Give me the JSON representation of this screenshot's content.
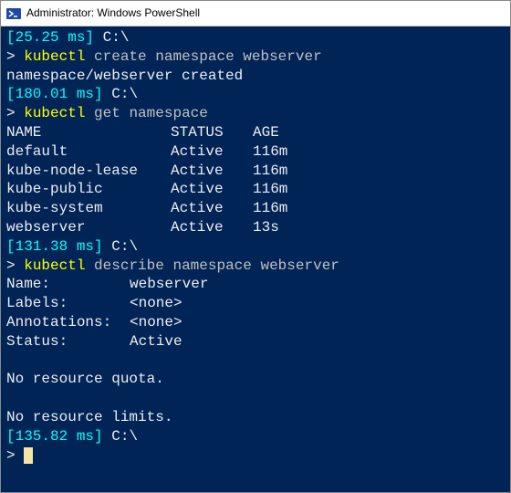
{
  "window": {
    "title": "Administrator: Windows PowerShell",
    "icon": "powershell-icon"
  },
  "colors": {
    "bg": "#012456",
    "cyan": "#00ffff",
    "yellow": "#ffff00",
    "white": "#eeedf0"
  },
  "prompts": {
    "p0": {
      "timing": "[25.25 ms]",
      "path": "C:\\",
      "caret": ">",
      "cmd": "kubectl",
      "args": "create namespace webserver"
    },
    "out0": "namespace/webserver created",
    "p1": {
      "timing": "[180.01 ms]",
      "path": "C:\\",
      "caret": ">",
      "cmd": "kubectl",
      "args": "get namespace"
    },
    "table": {
      "header": {
        "name": "NAME",
        "status": "STATUS",
        "age": "AGE"
      },
      "rows": [
        {
          "name": "default",
          "status": "Active",
          "age": "116m"
        },
        {
          "name": "kube-node-lease",
          "status": "Active",
          "age": "116m"
        },
        {
          "name": "kube-public",
          "status": "Active",
          "age": "116m"
        },
        {
          "name": "kube-system",
          "status": "Active",
          "age": "116m"
        },
        {
          "name": "webserver",
          "status": "Active",
          "age": "13s"
        }
      ]
    },
    "p2": {
      "timing": "[131.38 ms]",
      "path": "C:\\",
      "caret": ">",
      "cmd": "kubectl",
      "args": "describe namespace webserver"
    },
    "describe": {
      "name_k": "Name:",
      "name_v": "webserver",
      "labels_k": "Labels:",
      "labels_v": "<none>",
      "annot_k": "Annotations:",
      "annot_v": "<none>",
      "status_k": "Status:",
      "status_v": "Active",
      "quota": "No resource quota.",
      "limits": "No resource limits."
    },
    "p3": {
      "timing": "[135.82 ms]",
      "path": "C:\\",
      "caret": ">"
    }
  }
}
